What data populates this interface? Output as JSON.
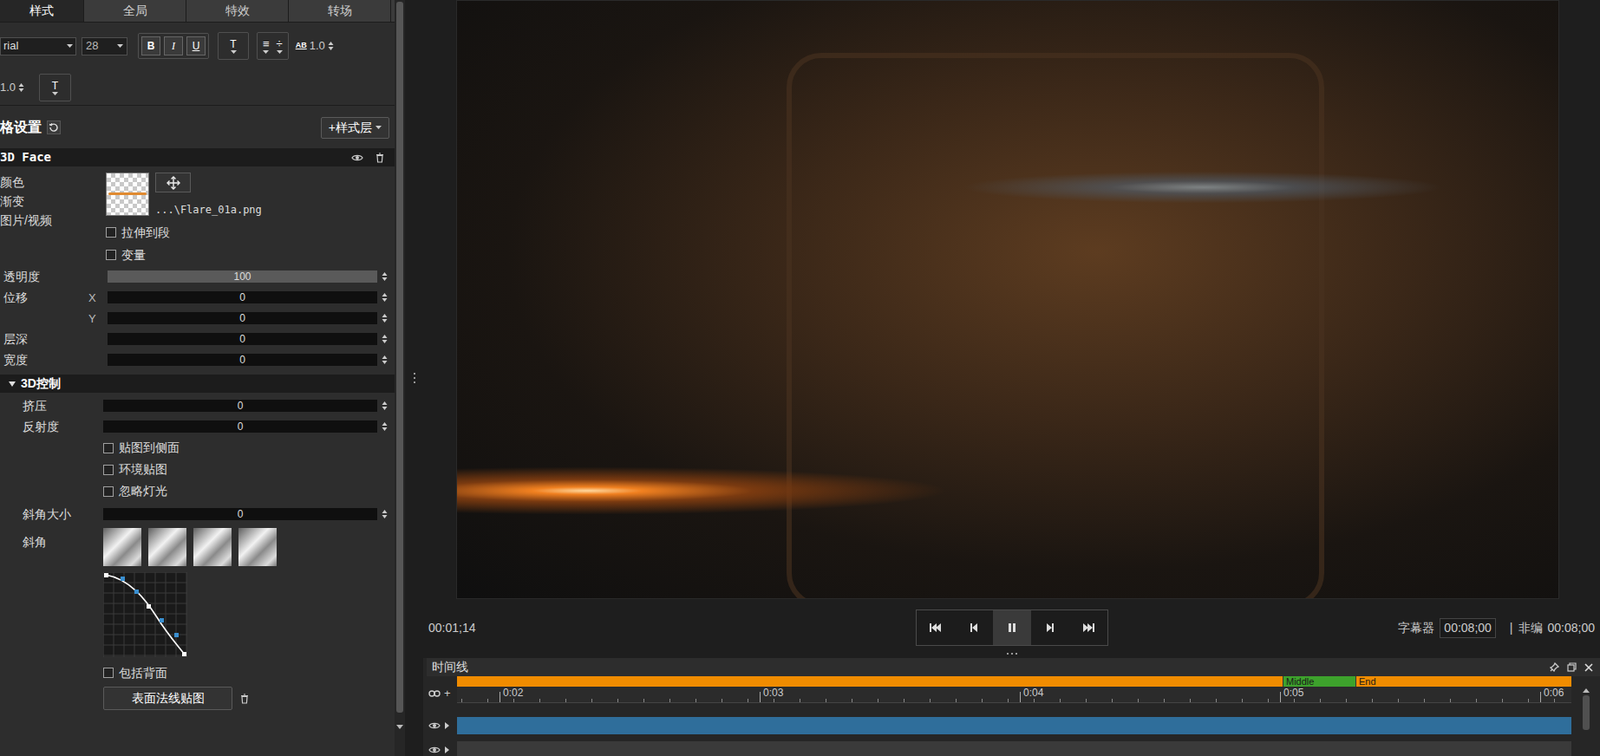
{
  "tabs": [
    {
      "label": "样式",
      "selected": true
    },
    {
      "label": "全局",
      "selected": false
    },
    {
      "label": "特效",
      "selected": false
    },
    {
      "label": "转场",
      "selected": false
    }
  ],
  "toolbar": {
    "font": "rial",
    "size": "28",
    "bold": "B",
    "italic": "I",
    "underline": "U",
    "text_style": "T",
    "align": "≡",
    "distribute": "÷",
    "spacing_label": "AB",
    "spacing": "1.0",
    "line_spacing": "1.0",
    "direction": "T"
  },
  "style_settings": {
    "title": "格设置",
    "add_layer": "+样式层"
  },
  "layer": {
    "name": "3D Face",
    "visible": true
  },
  "fill": {
    "labels": [
      "颜色",
      "渐变",
      "图片/视频"
    ],
    "file": "...\\Flare_01a.png"
  },
  "checks": [
    {
      "label": "拉伸到段",
      "checked": false
    },
    {
      "label": "变量",
      "checked": false
    }
  ],
  "sliders": [
    {
      "label": "透明度",
      "value": "100",
      "level": 1
    },
    {
      "label": "位移",
      "axis": "X",
      "value": "0",
      "level": 0
    },
    {
      "axis": "Y",
      "value": "0",
      "level": 0
    },
    {
      "label": "层深",
      "value": "0",
      "level": 0
    },
    {
      "label": "宽度",
      "value": "0",
      "level": 0
    }
  ],
  "control_group": {
    "label": "3D控制",
    "expanded": true
  },
  "control_sliders": [
    {
      "label": "挤压",
      "value": "0",
      "level": 0
    },
    {
      "label": "反射度",
      "value": "0",
      "level": 0
    }
  ],
  "control_checks": [
    {
      "label": "贴图到侧面",
      "checked": false
    },
    {
      "label": "环境贴图",
      "checked": false
    },
    {
      "label": "忽略灯光",
      "checked": false
    }
  ],
  "bevel_size": {
    "label": "斜角大小",
    "value": "0",
    "level": 0
  },
  "bevel": {
    "label": "斜角"
  },
  "back_face": {
    "label": "包括背面",
    "checked": false
  },
  "normal_map": {
    "label": "表面法线贴图"
  },
  "player": {
    "timecode": "00:01;14",
    "controls": [
      {
        "kind": "start",
        "selected": false
      },
      {
        "kind": "prev",
        "selected": false
      },
      {
        "kind": "pause",
        "selected": true
      },
      {
        "kind": "next",
        "selected": false
      },
      {
        "kind": "end",
        "selected": false
      }
    ],
    "title_label": "字幕器",
    "title_duration": "00:08;00",
    "separator": "|",
    "edit_label": "非编",
    "edit_duration": "00:08;00"
  },
  "timeline": {
    "title": "时间线",
    "add": "+",
    "ruler": [
      "0:02",
      "0:03",
      "0:04",
      "0:05",
      "0:06"
    ],
    "markers": [
      {
        "label": "Middle",
        "color": "#3da22c"
      },
      {
        "label": "End",
        "color": "#f08c00"
      }
    ],
    "tracks": [
      {
        "visible": true,
        "color": "#2f6e9b"
      },
      {
        "visible": true,
        "color": "#3a3a3a"
      }
    ]
  }
}
